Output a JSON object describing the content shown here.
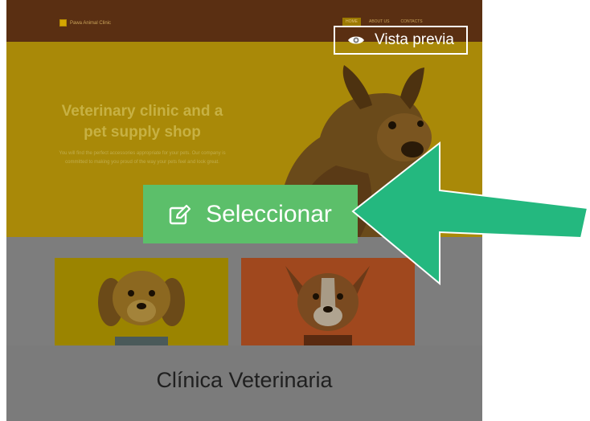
{
  "site": {
    "logo_text": "Pawa Animal Clinic",
    "nav": [
      "HOME",
      "ABOUT US",
      "CONTACTS"
    ],
    "hero_title": "Veterinary clinic and a pet supply shop",
    "hero_text": "You will find the perfect accessories appropriate for your pets. Our company is committed to making you proud of the way your pets feel and look great."
  },
  "overlay": {
    "preview_label": "Vista previa",
    "select_label": "Seleccionar"
  },
  "template": {
    "title": "Clínica Veterinaria"
  },
  "icons": {
    "preview": "eye-icon",
    "select": "edit-icon"
  },
  "colors": {
    "select_button": "#5cbf6a",
    "arrow": "#24b87f",
    "overlay_gray": "#7a7a7a"
  }
}
